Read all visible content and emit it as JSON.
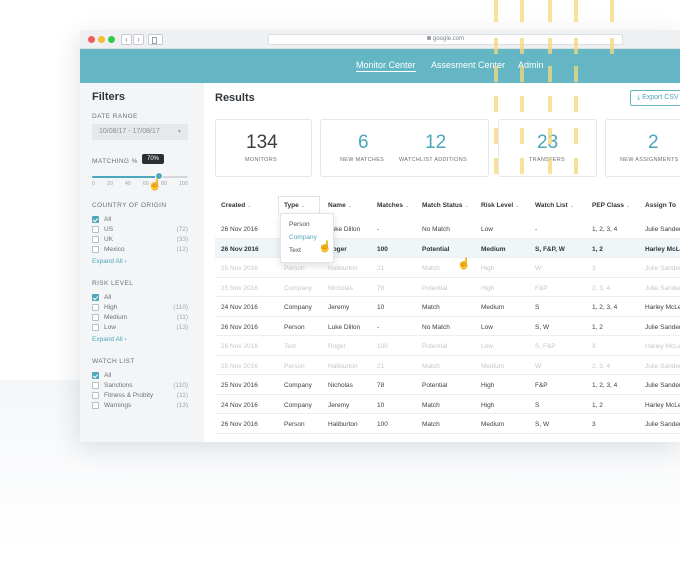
{
  "browser": {
    "url": "google.com",
    "back_glyph": "‹",
    "forward_glyph": "›"
  },
  "topnav": {
    "items": [
      {
        "label": "Monitor Center",
        "active": true
      },
      {
        "label": "Assesment Center",
        "active": false
      },
      {
        "label": "Admin",
        "active": false
      }
    ]
  },
  "sidebar": {
    "title": "Filters",
    "date_range": {
      "heading": "DATE RANGE",
      "value": "10/08/17 - 17/08/17",
      "chevron": "▾"
    },
    "matching": {
      "heading": "MATCHING %",
      "tooltip": "70%",
      "value_percent": 70,
      "ticks": [
        "0",
        "20",
        "40",
        "60",
        "80",
        "100"
      ]
    },
    "country": {
      "heading": "COUNTRY OF ORIGIN",
      "items": [
        {
          "label": "All",
          "count": "",
          "checked": true
        },
        {
          "label": "US",
          "count": "(72)",
          "checked": false
        },
        {
          "label": "UK",
          "count": "(33)",
          "checked": false
        },
        {
          "label": "Mexico",
          "count": "(12)",
          "checked": false
        }
      ],
      "expand": "Expand All ›"
    },
    "risk": {
      "heading": "RISK LEVEL",
      "items": [
        {
          "label": "All",
          "count": "",
          "checked": true
        },
        {
          "label": "High",
          "count": "(110)",
          "checked": false
        },
        {
          "label": "Medium",
          "count": "(11)",
          "checked": false
        },
        {
          "label": "Low",
          "count": "(13)",
          "checked": false
        }
      ],
      "expand": "Expand All ›"
    },
    "watchlist": {
      "heading": "WATCH LIST",
      "items": [
        {
          "label": "All",
          "count": "",
          "checked": true
        },
        {
          "label": "Sanctions",
          "count": "(110)",
          "checked": false
        },
        {
          "label": "Fitness & Probity",
          "count": "(11)",
          "checked": false
        },
        {
          "label": "Warnings",
          "count": "(13)",
          "checked": false
        }
      ]
    }
  },
  "main": {
    "title": "Results",
    "export_label": "Export CSV",
    "export_icon": "⤓",
    "stats": [
      {
        "value": "134",
        "label": "MONITORS"
      },
      {
        "value": "6",
        "label": "NEW MATCHES"
      },
      {
        "value": "12",
        "label": "WATCHLIST ADDITIONS"
      },
      {
        "value": "23",
        "label": "TRANSFERS"
      },
      {
        "value": "2",
        "label": "NEW ASSIGNMENTS"
      }
    ],
    "columns": [
      "Created",
      "Type",
      "Name",
      "Matches",
      "Match Status",
      "Risk Level",
      "Watch List",
      "PEP Class",
      "Assign To"
    ],
    "sort_caret": "⌄",
    "rows": [
      {
        "created": "26 Nov 2016",
        "type": "Person",
        "name": "Luke Dillon",
        "matches": "-",
        "status": "No Match",
        "risk": "Low",
        "watch": "-",
        "pep": "1, 2, 3, 4",
        "assign": "Julie Sanders",
        "state": "normal"
      },
      {
        "created": "26 Nov 2016",
        "type": "Text",
        "name": "Roger",
        "matches": "100",
        "status": "Potential",
        "risk": "Medium",
        "watch": "S, F&P, W",
        "pep": "1, 2",
        "assign": "Harley McLeod",
        "state": "hl"
      },
      {
        "created": "25 Nov 2016",
        "type": "Person",
        "name": "Haliburton",
        "matches": "21",
        "status": "Match",
        "risk": "High",
        "watch": "W",
        "pep": "3",
        "assign": "Julie Sanders",
        "state": "dim"
      },
      {
        "created": "25 Nov 2016",
        "type": "Company",
        "name": "Nicholas",
        "matches": "78",
        "status": "Potential",
        "risk": "High",
        "watch": "F&P",
        "pep": "2, 3, 4",
        "assign": "Julie Sanders",
        "state": "dim"
      },
      {
        "created": "24 Nov 2016",
        "type": "Company",
        "name": "Jeremy",
        "matches": "10",
        "status": "Match",
        "risk": "Medium",
        "watch": "S",
        "pep": "1, 2, 3, 4",
        "assign": "Harley McLeod",
        "state": "normal"
      },
      {
        "created": "26 Nov 2016",
        "type": "Person",
        "name": "Luke Dillon",
        "matches": "-",
        "status": "No Match",
        "risk": "Low",
        "watch": "S, W",
        "pep": "1, 2",
        "assign": "Julie Sanders",
        "state": "normal"
      },
      {
        "created": "26 Nov 2016",
        "type": "Text",
        "name": "Roger",
        "matches": "100",
        "status": "Potential",
        "risk": "Low",
        "watch": "S, F&P",
        "pep": "3",
        "assign": "Harley McLeod",
        "state": "dim"
      },
      {
        "created": "25 Nov 2016",
        "type": "Person",
        "name": "Haliburton",
        "matches": "21",
        "status": "Match",
        "risk": "Medium",
        "watch": "W",
        "pep": "2, 3, 4",
        "assign": "Julie Sanders",
        "state": "dim"
      },
      {
        "created": "25 Nov 2016",
        "type": "Company",
        "name": "Nicholas",
        "matches": "78",
        "status": "Potential",
        "risk": "High",
        "watch": "F&P",
        "pep": "1, 2, 3, 4",
        "assign": "Julie Sanders",
        "state": "normal"
      },
      {
        "created": "24 Nov 2016",
        "type": "Company",
        "name": "Jeremy",
        "matches": "10",
        "status": "Match",
        "risk": "High",
        "watch": "S",
        "pep": "1, 2",
        "assign": "Harley McLeod",
        "state": "normal"
      },
      {
        "created": "26 Nov 2016",
        "type": "Person",
        "name": "Haliburton",
        "matches": "100",
        "status": "Match",
        "risk": "Medium",
        "watch": "S, W",
        "pep": "3",
        "assign": "Julie Sanders",
        "state": "normal"
      }
    ],
    "type_dropdown": {
      "options": [
        "Person",
        "Company",
        "Text"
      ],
      "selected": "Company"
    }
  },
  "colors": {
    "accent": "#64b6c5",
    "accent_dark": "#4fa7ba",
    "stripe": "#f6d87a"
  }
}
